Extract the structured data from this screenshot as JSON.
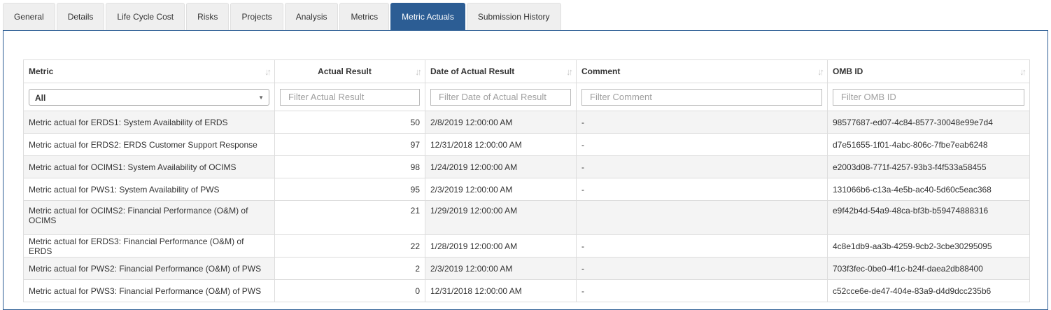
{
  "tabs": [
    {
      "label": "General"
    },
    {
      "label": "Details"
    },
    {
      "label": "Life Cycle Cost"
    },
    {
      "label": "Risks"
    },
    {
      "label": "Projects"
    },
    {
      "label": "Analysis"
    },
    {
      "label": "Metrics"
    },
    {
      "label": "Metric Actuals",
      "active": true
    },
    {
      "label": "Submission History"
    }
  ],
  "table": {
    "columns": [
      "Metric",
      "Actual Result",
      "Date of Actual Result",
      "Comment",
      "OMB ID"
    ],
    "sort_icon": "sort-arrows-icon",
    "filters": {
      "metric_selected": "All",
      "actual_placeholder": "Filter Actual Result",
      "date_placeholder": "Filter Date of Actual Result",
      "comment_placeholder": "Filter Comment",
      "omb_placeholder": "Filter OMB ID"
    },
    "rows": [
      {
        "metric": "Metric actual for ERDS1: System Availability of ERDS",
        "actual": "50",
        "date": "2/8/2019 12:00:00 AM",
        "comment": "-",
        "omb": "98577687-ed07-4c84-8577-30048e99e7d4"
      },
      {
        "metric": "Metric actual for ERDS2: ERDS Customer Support Response",
        "actual": "97",
        "date": "12/31/2018 12:00:00 AM",
        "comment": "-",
        "omb": "d7e51655-1f01-4abc-806c-7fbe7eab6248"
      },
      {
        "metric": "Metric actual for OCIMS1: System Availability of OCIMS",
        "actual": "98",
        "date": "1/24/2019 12:00:00 AM",
        "comment": "-",
        "omb": "e2003d08-771f-4257-93b3-f4f533a58455"
      },
      {
        "metric": "Metric actual for PWS1: System Availability of PWS",
        "actual": "95",
        "date": "2/3/2019 12:00:00 AM",
        "comment": "-",
        "omb": "131066b6-c13a-4e5b-ac40-5d60c5eac368"
      },
      {
        "metric": "Metric actual for OCIMS2: Financial Performance (O&M) of OCIMS",
        "actual": "21",
        "date": "1/29/2019 12:00:00 AM",
        "comment": "",
        "omb": "e9f42b4d-54a9-48ca-bf3b-b59474888316"
      },
      {
        "metric": "Metric actual for ERDS3: Financial Performance (O&M) of ERDS",
        "actual": "22",
        "date": "1/28/2019 12:00:00 AM",
        "comment": "-",
        "omb": "4c8e1db9-aa3b-4259-9cb2-3cbe30295095"
      },
      {
        "metric": "Metric actual for PWS2: Financial Performance (O&M) of PWS",
        "actual": "2",
        "date": "2/3/2019 12:00:00 AM",
        "comment": "-",
        "omb": "703f3fec-0be0-4f1c-b24f-daea2db88400"
      },
      {
        "metric": "Metric actual for PWS3: Financial Performance (O&M) of PWS",
        "actual": "0",
        "date": "12/31/2018 12:00:00 AM",
        "comment": "-",
        "omb": "c52cce6e-de47-404e-83a9-d4d9dcc235b6"
      }
    ]
  }
}
